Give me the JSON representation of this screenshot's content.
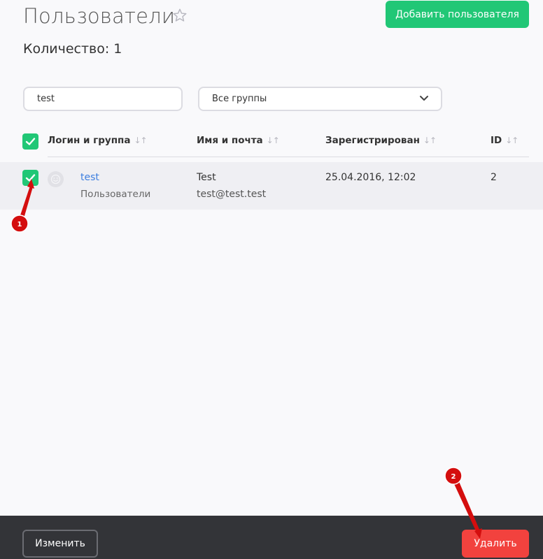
{
  "header": {
    "title": "Пользователи",
    "add_user_label": "Добавить пользователя",
    "count_text": "Количество: 1"
  },
  "filters": {
    "search_value": "test",
    "group_selected": "Все группы"
  },
  "table": {
    "columns": [
      {
        "label": "Логин и группа"
      },
      {
        "label": "Имя и почта"
      },
      {
        "label": "Зарегистрирован"
      },
      {
        "label": "ID"
      }
    ],
    "rows": [
      {
        "login": "test",
        "group": "Пользователи",
        "name": "Test",
        "email": "test@test.test",
        "registered": "25.04.2016, 12:02",
        "id": "2",
        "selected": true
      }
    ]
  },
  "bottom_bar": {
    "edit_label": "Изменить",
    "delete_label": "Удалить"
  },
  "annotations": {
    "markers": [
      "1",
      "2"
    ]
  },
  "icons": {
    "favorite": "star-icon",
    "dropdown": "chevron-down-icon",
    "checkbox": "check-icon",
    "avatar": "smiley-icon",
    "sort": "sort-arrows-icon"
  },
  "colors": {
    "accent_green": "#21c776",
    "danger_red": "#f2423e",
    "link_blue": "#3e7fe0",
    "bottom_bar": "#333438",
    "annotation_red": "#d40e0e"
  }
}
